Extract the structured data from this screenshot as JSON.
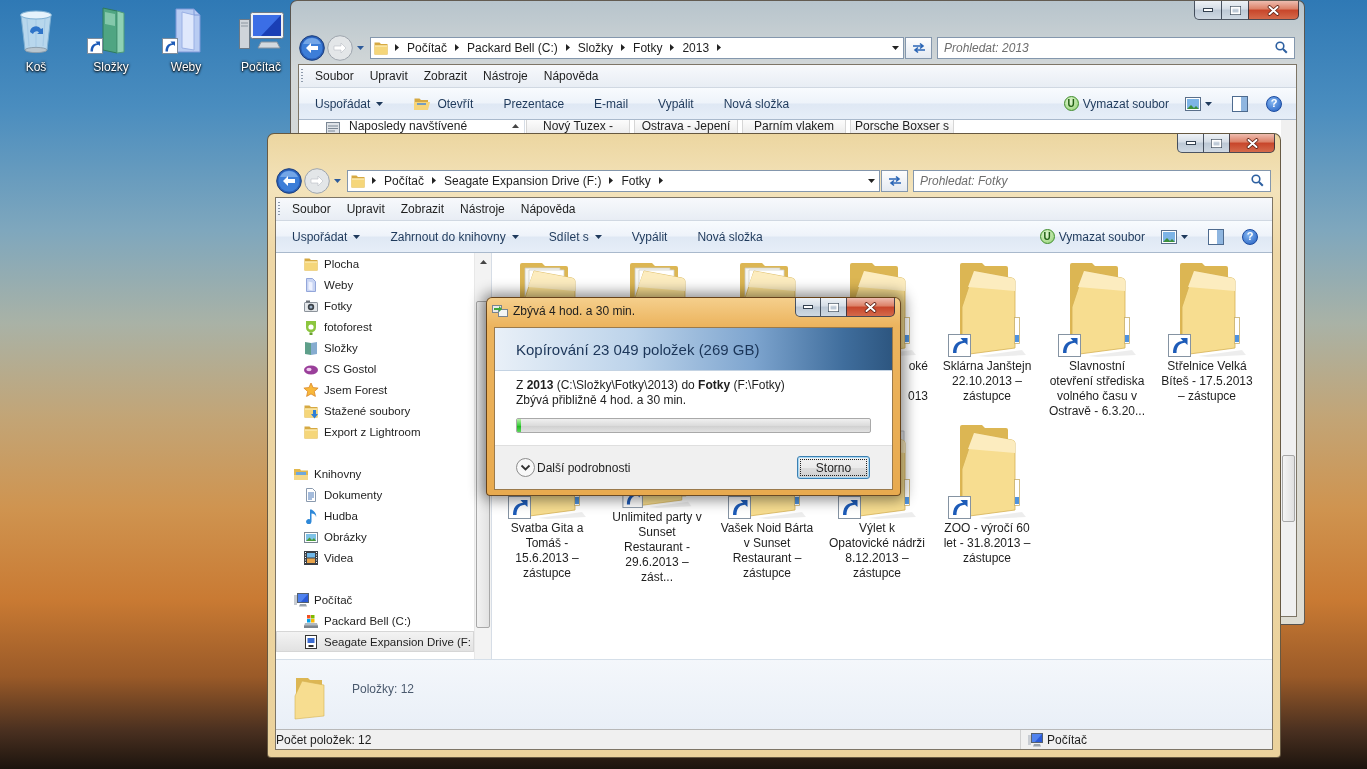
{
  "desktop": {
    "icons": [
      {
        "label": "Koš",
        "kind": "recycle_bin",
        "shortcut": false
      },
      {
        "label": "Složky",
        "kind": "tall_folder",
        "shortcut": true
      },
      {
        "label": "Weby",
        "kind": "glass_folder",
        "shortcut": true
      },
      {
        "label": "Počítač",
        "kind": "computer",
        "shortcut": false
      }
    ]
  },
  "back_window": {
    "address": [
      "Počítač",
      "Packard Bell (C:)",
      "Složky",
      "Fotky",
      "2013"
    ],
    "search": {
      "placeholder": "Prohledat: 2013"
    },
    "menu": [
      "Soubor",
      "Upravit",
      "Zobrazit",
      "Nástroje",
      "Nápověda"
    ],
    "toolbar": [
      {
        "label": "Uspořádat",
        "kind": "menu"
      },
      {
        "label": "Otevřít",
        "kind": "open"
      },
      {
        "label": "Prezentace",
        "kind": "plain"
      },
      {
        "label": "E-mail",
        "kind": "plain"
      },
      {
        "label": "Vypálit",
        "kind": "plain"
      },
      {
        "label": "Nová složka",
        "kind": "plain"
      }
    ],
    "extension_button": {
      "badge": "U",
      "label": "Vymazat soubor"
    },
    "help": "?",
    "nav_pane": [
      {
        "label": "Naposledy navštívené",
        "kind": "recent",
        "selected": false
      }
    ],
    "items": [
      {
        "label": "Nový Tuzex -",
        "selected": false
      },
      {
        "label": "Ostrava - Jepení",
        "selected": false
      },
      {
        "label": "Parním vlakem",
        "selected": false
      },
      {
        "label": "Porsche Boxser s",
        "selected": false
      }
    ]
  },
  "front_window": {
    "address": [
      "Počítač",
      "Seagate Expansion Drive (F:)",
      "Fotky"
    ],
    "search": {
      "placeholder": "Prohledat: Fotky"
    },
    "menu": [
      "Soubor",
      "Upravit",
      "Zobrazit",
      "Nástroje",
      "Nápověda"
    ],
    "toolbar": [
      {
        "label": "Uspořádat",
        "kind": "menu"
      },
      {
        "label": "Zahrnout do knihovny",
        "kind": "menu"
      },
      {
        "label": "Sdílet s",
        "kind": "menu"
      },
      {
        "label": "Vypálit",
        "kind": "plain"
      },
      {
        "label": "Nová složka",
        "kind": "plain"
      }
    ],
    "extension_button": {
      "badge": "U",
      "label": "Vymazat soubor"
    },
    "help": "?",
    "sidebar": {
      "favorites": [
        {
          "label": "Plocha",
          "kind": "folder",
          "selected": false
        },
        {
          "label": "Weby",
          "kind": "web_folder",
          "selected": false
        },
        {
          "label": "Fotky",
          "kind": "camera",
          "selected": false
        },
        {
          "label": "fotoforest",
          "kind": "leaf_logo",
          "selected": false
        },
        {
          "label": "Složky",
          "kind": "book",
          "selected": false
        },
        {
          "label": "CS Gostol",
          "kind": "purple_logo",
          "selected": false
        },
        {
          "label": "Jsem Forest",
          "kind": "star",
          "selected": false
        },
        {
          "label": "Stažené soubory",
          "kind": "downloads",
          "selected": false
        },
        {
          "label": "Export z Lightroom",
          "kind": "folder",
          "selected": false
        }
      ],
      "groups": [
        {
          "label": "Knihovny",
          "kind": "libraries",
          "selected": false,
          "children": [
            {
              "label": "Dokumenty",
              "kind": "documents",
              "selected": false
            },
            {
              "label": "Hudba",
              "kind": "music",
              "selected": false
            },
            {
              "label": "Obrázky",
              "kind": "pictures",
              "selected": false
            },
            {
              "label": "Videa",
              "kind": "videos",
              "selected": false
            }
          ]
        },
        {
          "label": "Počítač",
          "kind": "computer",
          "selected": false,
          "children": [
            {
              "label": "Packard Bell (C:)",
              "kind": "system_drive",
              "selected": false
            },
            {
              "label": "Seagate Expansion Drive (F:",
              "kind": "external_drive",
              "selected": true
            }
          ]
        }
      ]
    },
    "items": [
      {
        "kind": "papers",
        "selected": false
      },
      {
        "kind": "papers",
        "selected": false
      },
      {
        "kind": "papers",
        "selected": false
      },
      {
        "kind": "plain",
        "selected": false,
        "label_fragments": [
          "oké",
          "013"
        ]
      },
      {
        "kind": "plain",
        "shortcut": true,
        "selected": false,
        "label": "Sklárna Janštejn 22.10.2013 – zástupce"
      },
      {
        "kind": "plain",
        "shortcut": true,
        "selected": false,
        "label": "Slavnostní otevření střediska volného času v Ostravě - 6.3.20..."
      },
      {
        "kind": "plain",
        "shortcut": true,
        "selected": false,
        "label": "Střelnice Velká Bíteš - 17.5.2013 – zástupce"
      },
      {
        "kind": "plain",
        "shortcut": true,
        "selected": false,
        "label": "Svatba Gita a Tomáš - 15.6.2013 – zástupce"
      },
      {
        "kind": "plain",
        "shortcut": true,
        "selected": false,
        "label": "Unlimited party v Sunset Restaurant - 29.6.2013 – zást..."
      },
      {
        "kind": "photos_dark",
        "shortcut": true,
        "selected": false,
        "label": "Vašek Noid Bárta v Sunset Restaurant – zástupce"
      },
      {
        "kind": "photos_light",
        "shortcut": true,
        "selected": false,
        "label": "Výlet k Opatovické nádrži 8.12.2013 – zástupce"
      },
      {
        "kind": "plain",
        "shortcut": true,
        "selected": false,
        "label": "ZOO - výročí 60 let - 31.8.2013 – zástupce"
      }
    ],
    "details": {
      "text": "Položky: 12"
    },
    "status_bar": {
      "text": "Počet položek: 12",
      "zone": "Počítač"
    }
  },
  "copy_dialog": {
    "title": "Zbývá 4 hod. a 30 min.",
    "heading": "Kopírování 23 049 položek (269 GB)",
    "route": "Z **2013** (C:\\Složky\\Fotky\\2013) do **Fotky** (F:\\Fotky)",
    "remaining": "Zbývá přibližně 4 hod. a 30 min.",
    "progress": {
      "level": 0.012
    },
    "details_toggle": {
      "label": "Další podrobnosti",
      "expanded": false
    },
    "buttons": [
      {
        "label": "Storno",
        "focused": true
      }
    ]
  }
}
